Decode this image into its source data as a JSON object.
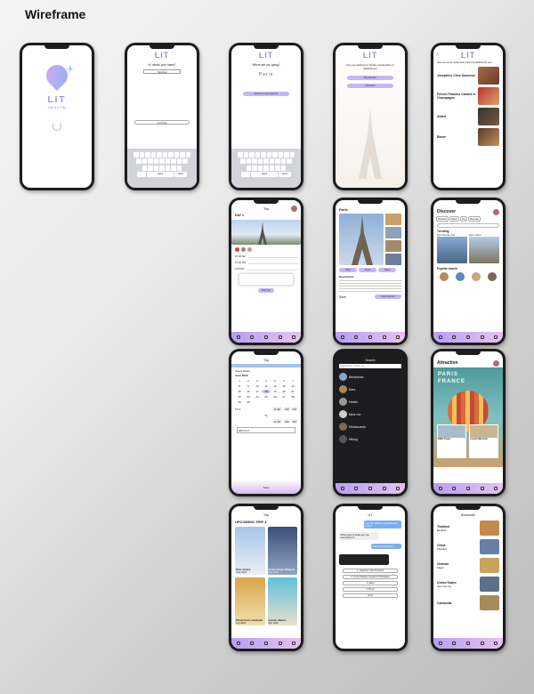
{
  "page_title": "Wireframe",
  "brand": {
    "logo_text": "LIT",
    "tagline": "Life's A Trip"
  },
  "onboarding": {
    "name_question": "Hi, what's your name?",
    "name_value": "Yanning",
    "continue": "Continue",
    "where_question": "Where are you going?",
    "where_value": "Paris",
    "discover_button": "Discover new places!",
    "looking_question": "Are you looking for hotels, restaurants or attractions?",
    "option1": "Restaurant",
    "option2": "Attraction"
  },
  "keyboard": {
    "space": "space",
    "return": "return"
  },
  "restaurants": {
    "intro": "Here are some restaurants recommendations for you!",
    "items": [
      "Joséphine Chez Dumonet",
      "French Paradox Canard & Champagne",
      "Allard",
      "Bimer"
    ]
  },
  "trip_detail": {
    "title": "Trip",
    "day": "DAY 1",
    "times": [
      "10:00 AM",
      "12:00 PM",
      "2:00 PM"
    ],
    "edit": "Edit Trip"
  },
  "paris_detail": {
    "title": "Paris",
    "description_label": "Description",
    "btn_map": "Map",
    "btn_food": "Food",
    "btn_hotel": "Hotel",
    "save": "Save",
    "add_itinerary": "Add Itinerary"
  },
  "discover": {
    "title": "Discover",
    "filters": [
      "Attraction",
      "Beach",
      "City",
      "Mountain"
    ],
    "trending": "Trending",
    "trend_items": [
      "New York City, USA",
      "Paris, France"
    ],
    "popular": "Popular search"
  },
  "calendar": {
    "title": "Trip",
    "select_dates": "Select Dates",
    "month": "June 2023",
    "days": [
      "1",
      "2",
      "3",
      "4",
      "5",
      "6",
      "7",
      "8",
      "9",
      "10",
      "11",
      "12",
      "13",
      "14",
      "15",
      "16",
      "17",
      "18",
      "19",
      "20",
      "21",
      "22",
      "23",
      "24",
      "25",
      "26",
      "27",
      "28",
      "29",
      "30"
    ],
    "time_label": "Time",
    "to_label": "To",
    "time1": "11:30",
    "time2": "11:30",
    "am": "AM",
    "pm": "PM",
    "search_placeholder": "What for?",
    "save": "Save"
  },
  "search": {
    "title": "Search",
    "placeholder": "Restaurants, hotels, etc",
    "items": [
      "Attractions",
      "Bars",
      "Hotels",
      "Near me",
      "Restaurants",
      "Hiking"
    ]
  },
  "attraction": {
    "title": "Attraction",
    "hero1": "PARIS",
    "hero2": "FRANCE",
    "card1": "Eiffel Tower",
    "card2": "Louvre Museum"
  },
  "upcoming": {
    "title": "Trip",
    "heading": "UPCOMING TRIP",
    "count": "4",
    "trips": [
      {
        "name": "Paris, France",
        "date": "June 2023"
      },
      {
        "name": "Kuala Lumpur, Malaysia",
        "date": "July 2023"
      },
      {
        "name": "Phnom Penh, Cambodia",
        "date": "Aug 2023"
      },
      {
        "name": "Cancun, Mexico",
        "date": "Sep 2023"
      }
    ]
  },
  "chat": {
    "title": "LIT",
    "bubbles": [
      "Hey LIT! What is a good food in Paris?",
      "What types of foods are you interested in?",
      "French food please!"
    ],
    "options": [
      "1. Joséphine Chez Dumonet",
      "2. French Paradox Canard & Champagne",
      "3. Allard",
      "4. Bimer",
      "Send"
    ]
  },
  "bookmark": {
    "title": "Bookmark",
    "countries": [
      {
        "name": "Thailand",
        "city": "Bangkok"
      },
      {
        "name": "China",
        "city": "Shanghai"
      },
      {
        "name": "Vietnam",
        "city": "Saigon"
      },
      {
        "name": "United States",
        "city": "New York City"
      },
      {
        "name": "Cambodia",
        "city": ""
      }
    ]
  },
  "colors": {
    "accent": "#9c87ea",
    "accent_light": "#c6b6f7",
    "tabbar_from": "#b79ff2",
    "tabbar_to": "#e6c2f0",
    "dark_screen": "#1d1d20"
  }
}
